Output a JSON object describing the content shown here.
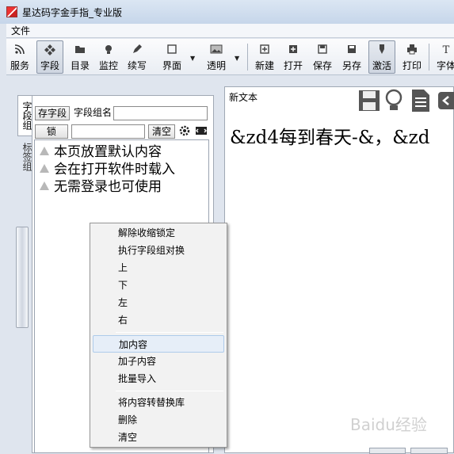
{
  "window": {
    "title": "星达码字金手指_专业版"
  },
  "menu": {
    "file": "文件"
  },
  "toolbar": {
    "items": [
      {
        "label": "服务",
        "icon": "rss-icon"
      },
      {
        "label": "字段",
        "icon": "diamond-icon"
      },
      {
        "label": "目录",
        "icon": "folder-icon"
      },
      {
        "label": "监控",
        "icon": "bulb-icon"
      },
      {
        "label": "续写",
        "icon": "pen-icon"
      },
      {
        "label": "界面",
        "icon": "window-icon"
      },
      {
        "label": "透明",
        "icon": "image-icon"
      },
      {
        "label": "新建",
        "icon": "new-icon"
      },
      {
        "label": "打开",
        "icon": "open-icon"
      },
      {
        "label": "保存",
        "icon": "save-icon"
      },
      {
        "label": "另存",
        "icon": "saveas-icon"
      },
      {
        "label": "激活",
        "icon": "activate-icon"
      },
      {
        "label": "打印",
        "icon": "print-icon"
      },
      {
        "label": "字体",
        "icon": "font-icon"
      }
    ]
  },
  "side_tabs": {
    "fields": "字段组",
    "tags": "标签组"
  },
  "left_panel": {
    "save_field_button": "存字段",
    "field_group_name_label": "字段组名",
    "lock_button": "锁",
    "clear_button": "清空",
    "items": [
      "本页放置默认内容",
      "会在打开软件时载入",
      "无需登录也可使用"
    ]
  },
  "right_panel": {
    "tab_label": "新文本",
    "content": "&zd4每到春天-&，&zd"
  },
  "context_menu": {
    "groups": [
      [
        "解除收缩锁定",
        "执行字段组对换",
        "上",
        "下",
        "左",
        "右"
      ],
      [
        "加内容",
        "加子内容",
        "批量导入"
      ],
      [
        "将内容转替换库",
        "删除",
        "清空"
      ]
    ],
    "highlighted": "加内容"
  },
  "watermark": "Baidu经验",
  "colors": {
    "title_bar": "#c6d6ea",
    "highlight": "#e6eef8",
    "panel_bg": "#dfe5ee"
  }
}
